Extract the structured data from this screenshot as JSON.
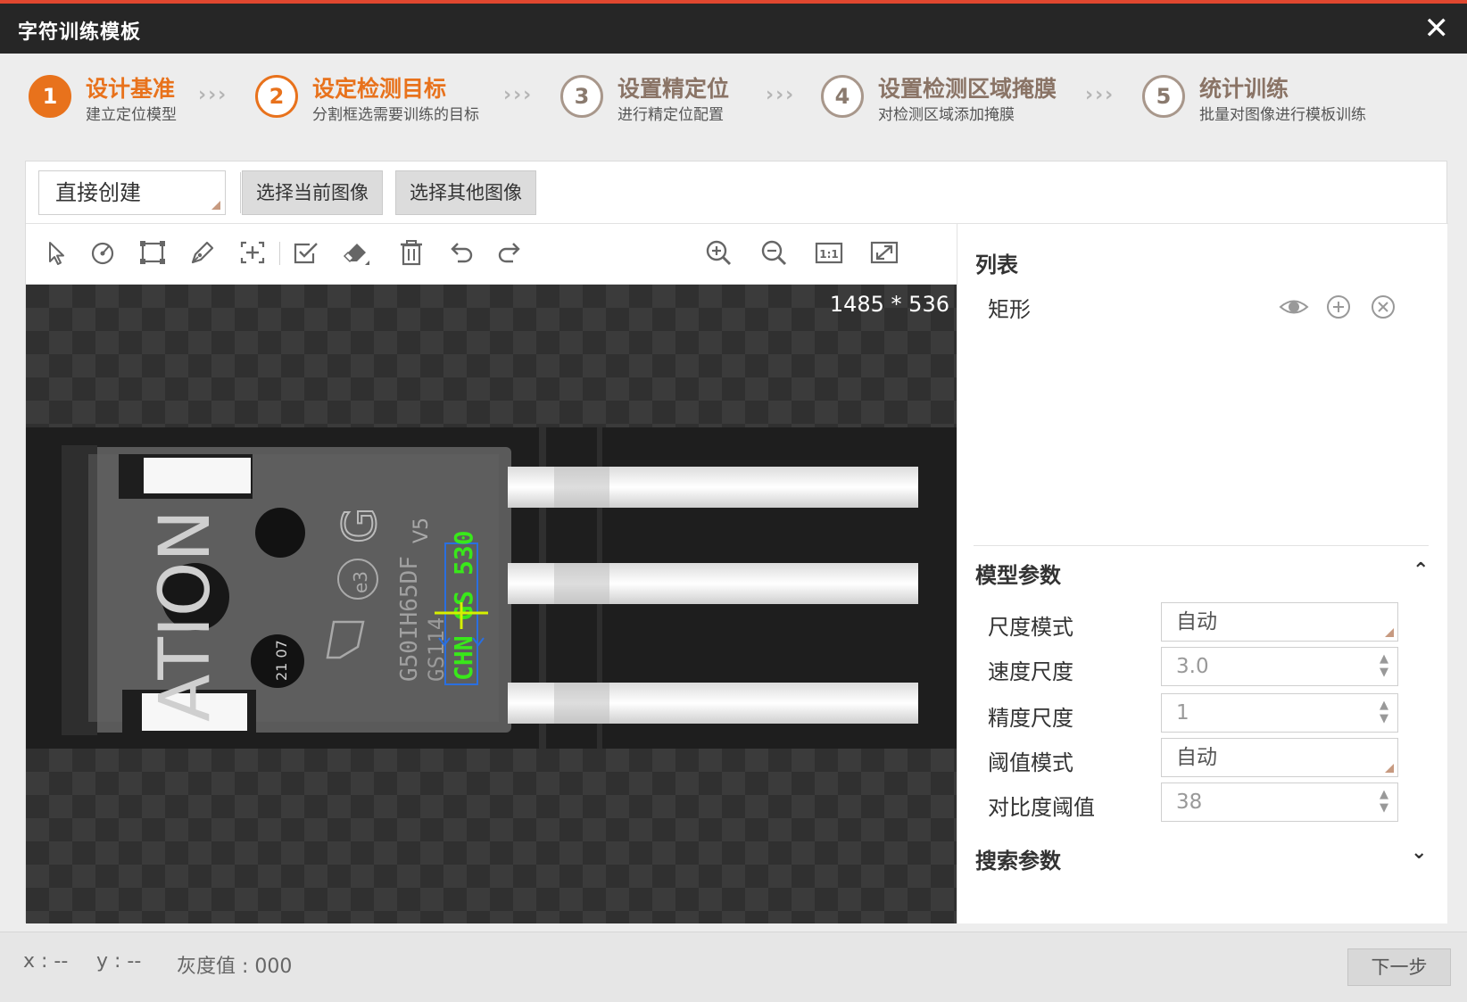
{
  "window": {
    "title": "字符训练模板",
    "close_glyph": "✕"
  },
  "steps": [
    {
      "number": "1",
      "title": "设计基准",
      "subtitle": "建立定位模型",
      "state": "done"
    },
    {
      "number": "2",
      "title": "设定检测目标",
      "subtitle": "分割框选需要训练的目标",
      "state": "active"
    },
    {
      "number": "3",
      "title": "设置精定位",
      "subtitle": "进行精定位配置",
      "state": "pending"
    },
    {
      "number": "4",
      "title": "设置检测区域掩膜",
      "subtitle": "对检测区域添加掩膜",
      "state": "pending"
    },
    {
      "number": "5",
      "title": "统计训练",
      "subtitle": "批量对图像进行模板训练",
      "state": "pending"
    }
  ],
  "step_separator": "›››",
  "topbar": {
    "create_mode": "直接创建",
    "select_current_image": "选择当前图像",
    "select_other_image": "选择其他图像"
  },
  "toolbar": {
    "tools": [
      "select-arrow-icon",
      "circle-tool-icon",
      "rectangle-tool-icon",
      "pen-tool-icon",
      "crosshair-add-icon",
      "check-edit-icon",
      "eraser-icon",
      "trash-icon",
      "undo-icon",
      "redo-icon"
    ],
    "view_tools": [
      "zoom-in-icon",
      "zoom-out-icon",
      "actual-size-icon",
      "fit-window-icon"
    ],
    "actual_size_label": "1:1"
  },
  "canvas": {
    "image_size": "1485 * 536",
    "chip_text": {
      "brand_partial": "ATION",
      "g_mark": "G",
      "v_mark": "V5",
      "e3": "e3",
      "part_number": "G50IH65DF",
      "lot": "GS114",
      "date": "21 07",
      "selected_text": "CHN GS 530"
    },
    "colors": {
      "selection": "#2a6fe0",
      "roi_text": "#39e81a",
      "marker": "#d6f000"
    }
  },
  "list_panel": {
    "title": "列表",
    "items": [
      {
        "label": "矩形"
      }
    ]
  },
  "model_params": {
    "title": "模型参数",
    "fields": [
      {
        "label": "尺度模式",
        "value": "自动",
        "kind": "select"
      },
      {
        "label": "速度尺度",
        "value": "3.0",
        "kind": "number"
      },
      {
        "label": "精度尺度",
        "value": "1",
        "kind": "number"
      },
      {
        "label": "阈值模式",
        "value": "自动",
        "kind": "select"
      },
      {
        "label": "对比度阈值",
        "value": "38",
        "kind": "number"
      }
    ]
  },
  "search_params": {
    "title": "搜索参数"
  },
  "footer": {
    "x_label": "x : --",
    "y_label": "y : --",
    "gray_label": "灰度值 : 000",
    "next_button": "下一步"
  },
  "accent_color": "#e8721c"
}
